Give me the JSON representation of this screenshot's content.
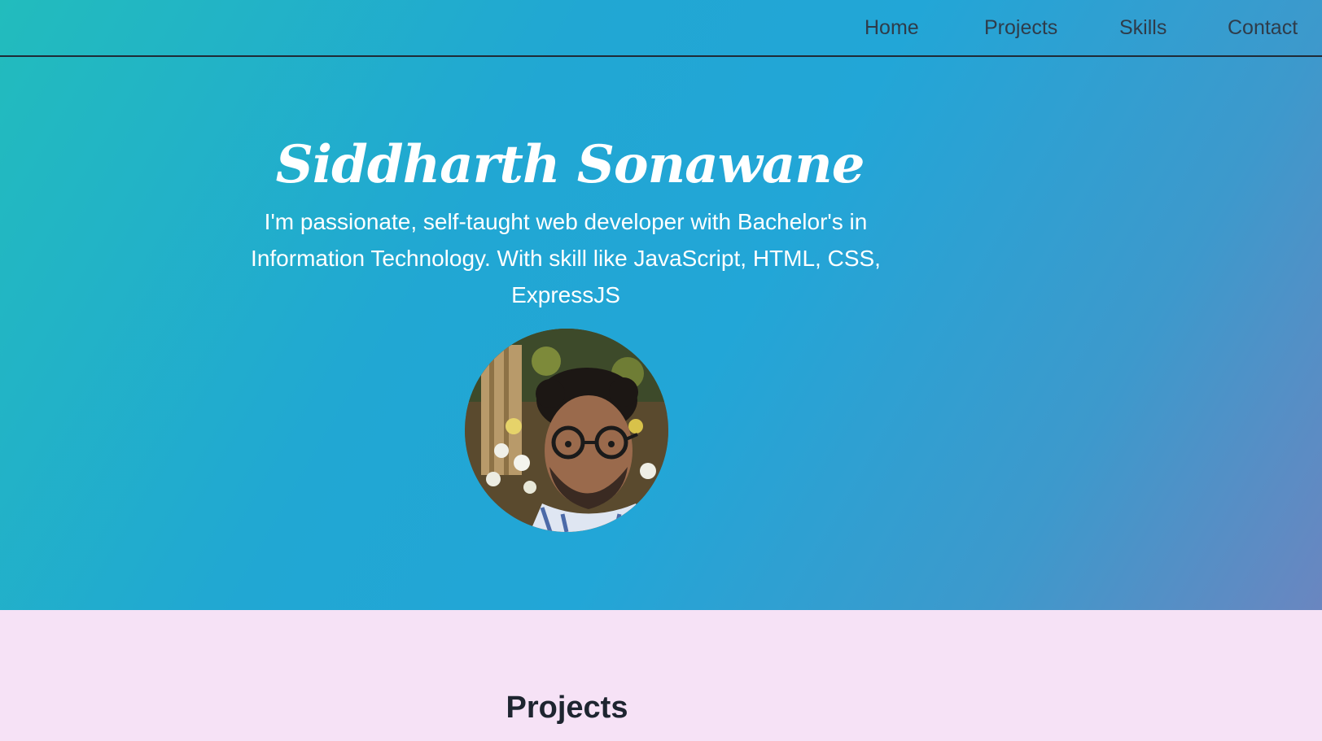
{
  "nav": {
    "items": [
      {
        "label": "Home"
      },
      {
        "label": "Projects"
      },
      {
        "label": "Skills"
      },
      {
        "label": "Contact"
      }
    ]
  },
  "hero": {
    "title": "Siddharth Sonawane",
    "intro": "I'm passionate, self-taught web developer with Bachelor's in Information Technology. With skill like JavaScript, HTML, CSS, ExpressJS",
    "avatar_icon": "profile-photo"
  },
  "projects": {
    "heading": "Projects"
  },
  "colors": {
    "hero_gradient_start": "#22bcbd",
    "hero_gradient_mid": "#21a7d3",
    "hero_gradient_end": "#6a86c0",
    "projects_background": "#f6e2f6",
    "nav_text": "#2f3c4a",
    "hero_text": "#ffffff"
  }
}
